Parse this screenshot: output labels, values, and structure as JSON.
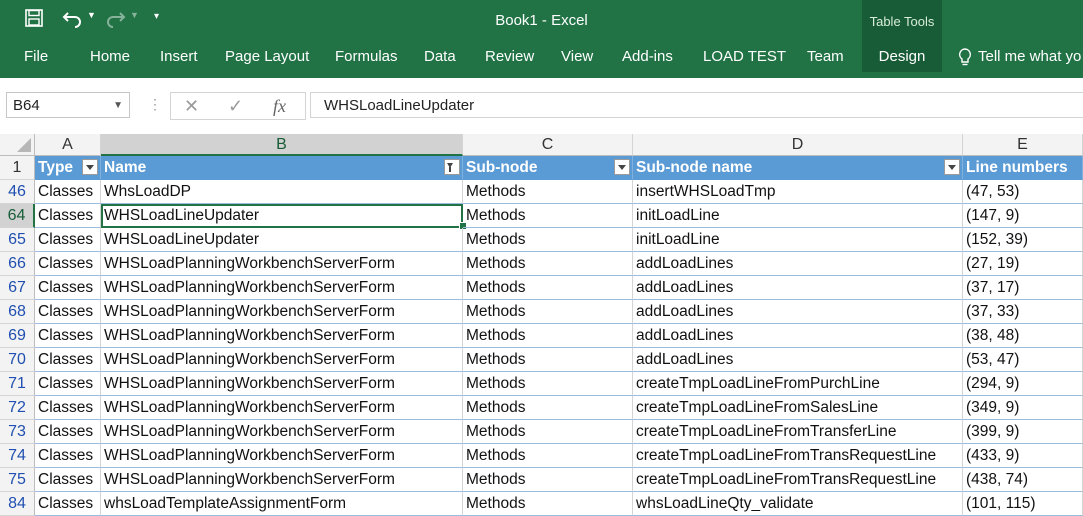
{
  "window": {
    "title": "Book1 - Excel",
    "context_tab_group": "Table Tools"
  },
  "ribbon": {
    "tabs": [
      "File",
      "Home",
      "Insert",
      "Page Layout",
      "Formulas",
      "Data",
      "Review",
      "View",
      "Add-ins",
      "LOAD TEST",
      "Team",
      "Design"
    ],
    "active_tab": "Design",
    "tell_me": "Tell me what yo"
  },
  "formula_bar": {
    "name_box": "B64",
    "fx": "fx",
    "value": "WHSLoadLineUpdater"
  },
  "sheet": {
    "columns": [
      "A",
      "B",
      "C",
      "D",
      "E"
    ],
    "selected_column": "B",
    "header_row_number": "1",
    "table_headers": [
      "Type",
      "Name",
      "Sub-node",
      "Sub-node name",
      "Line numbers"
    ],
    "rows": [
      {
        "n": "46",
        "c": [
          "Classes",
          "WhsLoadDP",
          "Methods",
          "insertWHSLoadTmp",
          "(47, 53)"
        ]
      },
      {
        "n": "64",
        "c": [
          "Classes",
          "WHSLoadLineUpdater",
          "Methods",
          "initLoadLine",
          "(147, 9)"
        ]
      },
      {
        "n": "65",
        "c": [
          "Classes",
          "WHSLoadLineUpdater",
          "Methods",
          "initLoadLine",
          "(152, 39)"
        ]
      },
      {
        "n": "66",
        "c": [
          "Classes",
          "WHSLoadPlanningWorkbenchServerForm",
          "Methods",
          "addLoadLines",
          "(27, 19)"
        ]
      },
      {
        "n": "67",
        "c": [
          "Classes",
          "WHSLoadPlanningWorkbenchServerForm",
          "Methods",
          "addLoadLines",
          "(37, 17)"
        ]
      },
      {
        "n": "68",
        "c": [
          "Classes",
          "WHSLoadPlanningWorkbenchServerForm",
          "Methods",
          "addLoadLines",
          "(37, 33)"
        ]
      },
      {
        "n": "69",
        "c": [
          "Classes",
          "WHSLoadPlanningWorkbenchServerForm",
          "Methods",
          "addLoadLines",
          "(38, 48)"
        ]
      },
      {
        "n": "70",
        "c": [
          "Classes",
          "WHSLoadPlanningWorkbenchServerForm",
          "Methods",
          "addLoadLines",
          "(53, 47)"
        ]
      },
      {
        "n": "71",
        "c": [
          "Classes",
          "WHSLoadPlanningWorkbenchServerForm",
          "Methods",
          "createTmpLoadLineFromPurchLine",
          "(294, 9)"
        ]
      },
      {
        "n": "72",
        "c": [
          "Classes",
          "WHSLoadPlanningWorkbenchServerForm",
          "Methods",
          "createTmpLoadLineFromSalesLine",
          "(349, 9)"
        ]
      },
      {
        "n": "73",
        "c": [
          "Classes",
          "WHSLoadPlanningWorkbenchServerForm",
          "Methods",
          "createTmpLoadLineFromTransferLine",
          "(399, 9)"
        ]
      },
      {
        "n": "74",
        "c": [
          "Classes",
          "WHSLoadPlanningWorkbenchServerForm",
          "Methods",
          "createTmpLoadLineFromTransRequestLine",
          "(433, 9)"
        ]
      },
      {
        "n": "75",
        "c": [
          "Classes",
          "WHSLoadPlanningWorkbenchServerForm",
          "Methods",
          "createTmpLoadLineFromTransRequestLine",
          "(438, 74)"
        ]
      },
      {
        "n": "84",
        "c": [
          "Classes",
          "whsLoadTemplateAssignmentForm",
          "Methods",
          "whsLoadLineQty_validate",
          "(101, 115)"
        ]
      }
    ],
    "active_cell": {
      "row": "64",
      "col": "B"
    },
    "filtered_column": "Name"
  },
  "colors": {
    "excel_green": "#217346",
    "table_header": "#5b9bd5",
    "row_number_blue": "#1f4fb0"
  },
  "icons": [
    "save-icon",
    "undo-icon",
    "redo-icon",
    "customize-qat-icon",
    "lightbulb-icon",
    "cancel-icon",
    "enter-icon",
    "function-icon",
    "filter-dropdown-icon",
    "filter-active-icon"
  ]
}
